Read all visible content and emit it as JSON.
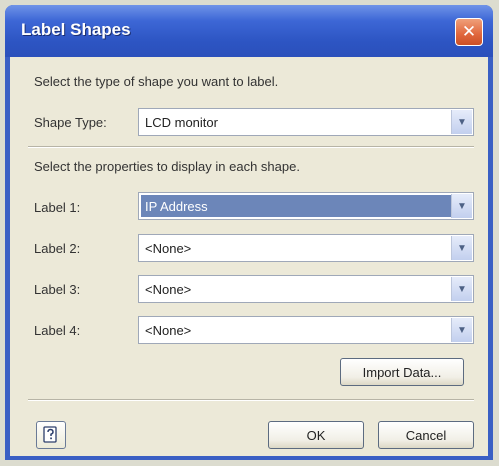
{
  "window": {
    "title": "Label Shapes",
    "close_glyph": "✕"
  },
  "instructions": {
    "shape_prompt": "Select the type of shape you want to label.",
    "properties_prompt": "Select the properties to display in each shape."
  },
  "shape_type": {
    "label": "Shape Type:",
    "value": "LCD monitor"
  },
  "labels": [
    {
      "label": "Label 1:",
      "value": "IP Address",
      "selected": true
    },
    {
      "label": "Label 2:",
      "value": "<None>",
      "selected": false
    },
    {
      "label": "Label 3:",
      "value": "<None>",
      "selected": false
    },
    {
      "label": "Label 4:",
      "value": "<None>",
      "selected": false
    }
  ],
  "buttons": {
    "import": "Import Data...",
    "ok": "OK",
    "cancel": "Cancel",
    "help_icon": "help-icon"
  },
  "colors": {
    "titlebar": "#2d55c3",
    "client": "#ece9d8",
    "selection": "#6c86b9",
    "close": "#e0663c"
  }
}
